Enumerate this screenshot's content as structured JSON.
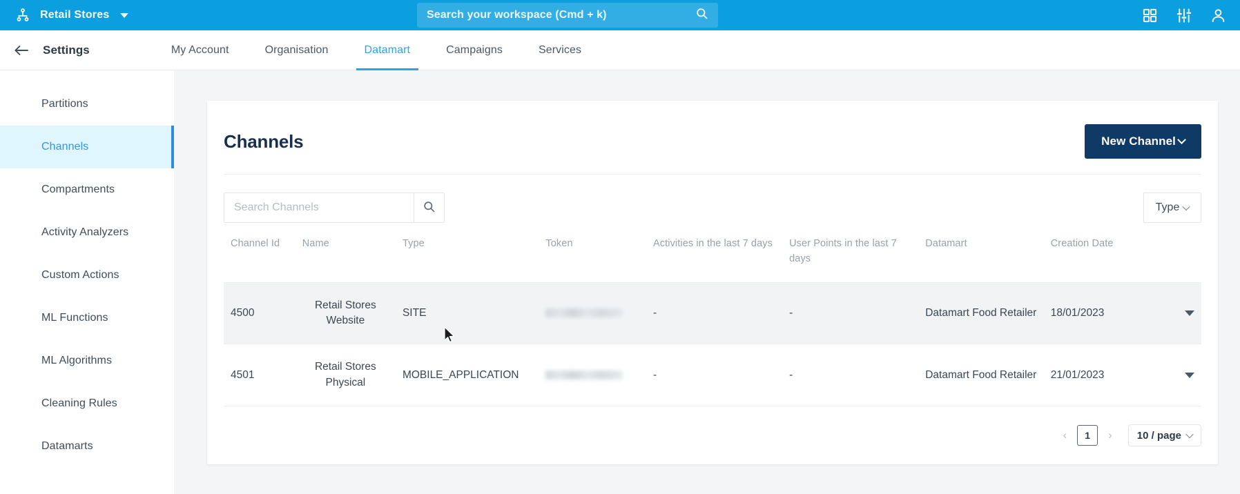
{
  "topbar": {
    "org_icon": "org-hierarchy-icon",
    "org_name": "Retail Stores",
    "search_placeholder": "Search your workspace (Cmd + k)",
    "search_icon": "search-icon",
    "icons": [
      "apps-grid-icon",
      "sliders-settings-icon",
      "user-account-icon"
    ]
  },
  "settings_header": {
    "back_icon": "back-arrow-icon",
    "title": "Settings",
    "tabs": [
      {
        "label": "My Account",
        "active": false
      },
      {
        "label": "Organisation",
        "active": false
      },
      {
        "label": "Datamart",
        "active": true
      },
      {
        "label": "Campaigns",
        "active": false
      },
      {
        "label": "Services",
        "active": false
      }
    ]
  },
  "sidebar": {
    "items": [
      {
        "label": "Partitions",
        "active": false
      },
      {
        "label": "Channels",
        "active": true
      },
      {
        "label": "Compartments",
        "active": false
      },
      {
        "label": "Activity Analyzers",
        "active": false
      },
      {
        "label": "Custom Actions",
        "active": false
      },
      {
        "label": "ML Functions",
        "active": false
      },
      {
        "label": "ML Algorithms",
        "active": false
      },
      {
        "label": "Cleaning Rules",
        "active": false
      },
      {
        "label": "Datamarts",
        "active": false
      }
    ]
  },
  "card": {
    "title": "Channels",
    "new_channel_label": "New Channel",
    "new_channel_icon": "chevron-down-icon"
  },
  "toolbar": {
    "search_placeholder": "Search Channels",
    "search_value": "",
    "search_icon": "search-icon",
    "type_filter_label": "Type",
    "type_filter_icon": "chevron-down-icon"
  },
  "table": {
    "columns": [
      "Channel Id",
      "Name",
      "Type",
      "Token",
      "Activities in the last 7 days",
      "User Points in the last 7 days",
      "Datamart",
      "Creation Date",
      ""
    ],
    "rows": [
      {
        "channel_id": "4500",
        "name": "Retail Stores Website",
        "type": "SITE",
        "token": "",
        "activities_7d": "-",
        "user_points_7d": "-",
        "datamart": "Datamart Food Retailer",
        "creation_date": "18/01/2023",
        "menu_icon": "caret-down-icon",
        "hovered": true
      },
      {
        "channel_id": "4501",
        "name": "Retail Stores Physical",
        "type": "MOBILE_APPLICATION",
        "token": "",
        "activities_7d": "-",
        "user_points_7d": "-",
        "datamart": "Datamart Food Retailer",
        "creation_date": "21/01/2023",
        "menu_icon": "caret-down-icon",
        "hovered": false
      }
    ]
  },
  "pagination": {
    "prev_icon": "chevron-left-icon",
    "next_icon": "chevron-right-icon",
    "current_page": "1",
    "page_size": "10 / page",
    "page_size_icon": "chevron-down-icon"
  },
  "colors": {
    "brand_blue": "#0c9fe0",
    "accent_blue": "#29a4e8",
    "primary_navy": "#103a66",
    "title_navy": "#18304f",
    "active_sidebar_bg": "#dff6fd",
    "page_bg": "#f4f5f7"
  }
}
